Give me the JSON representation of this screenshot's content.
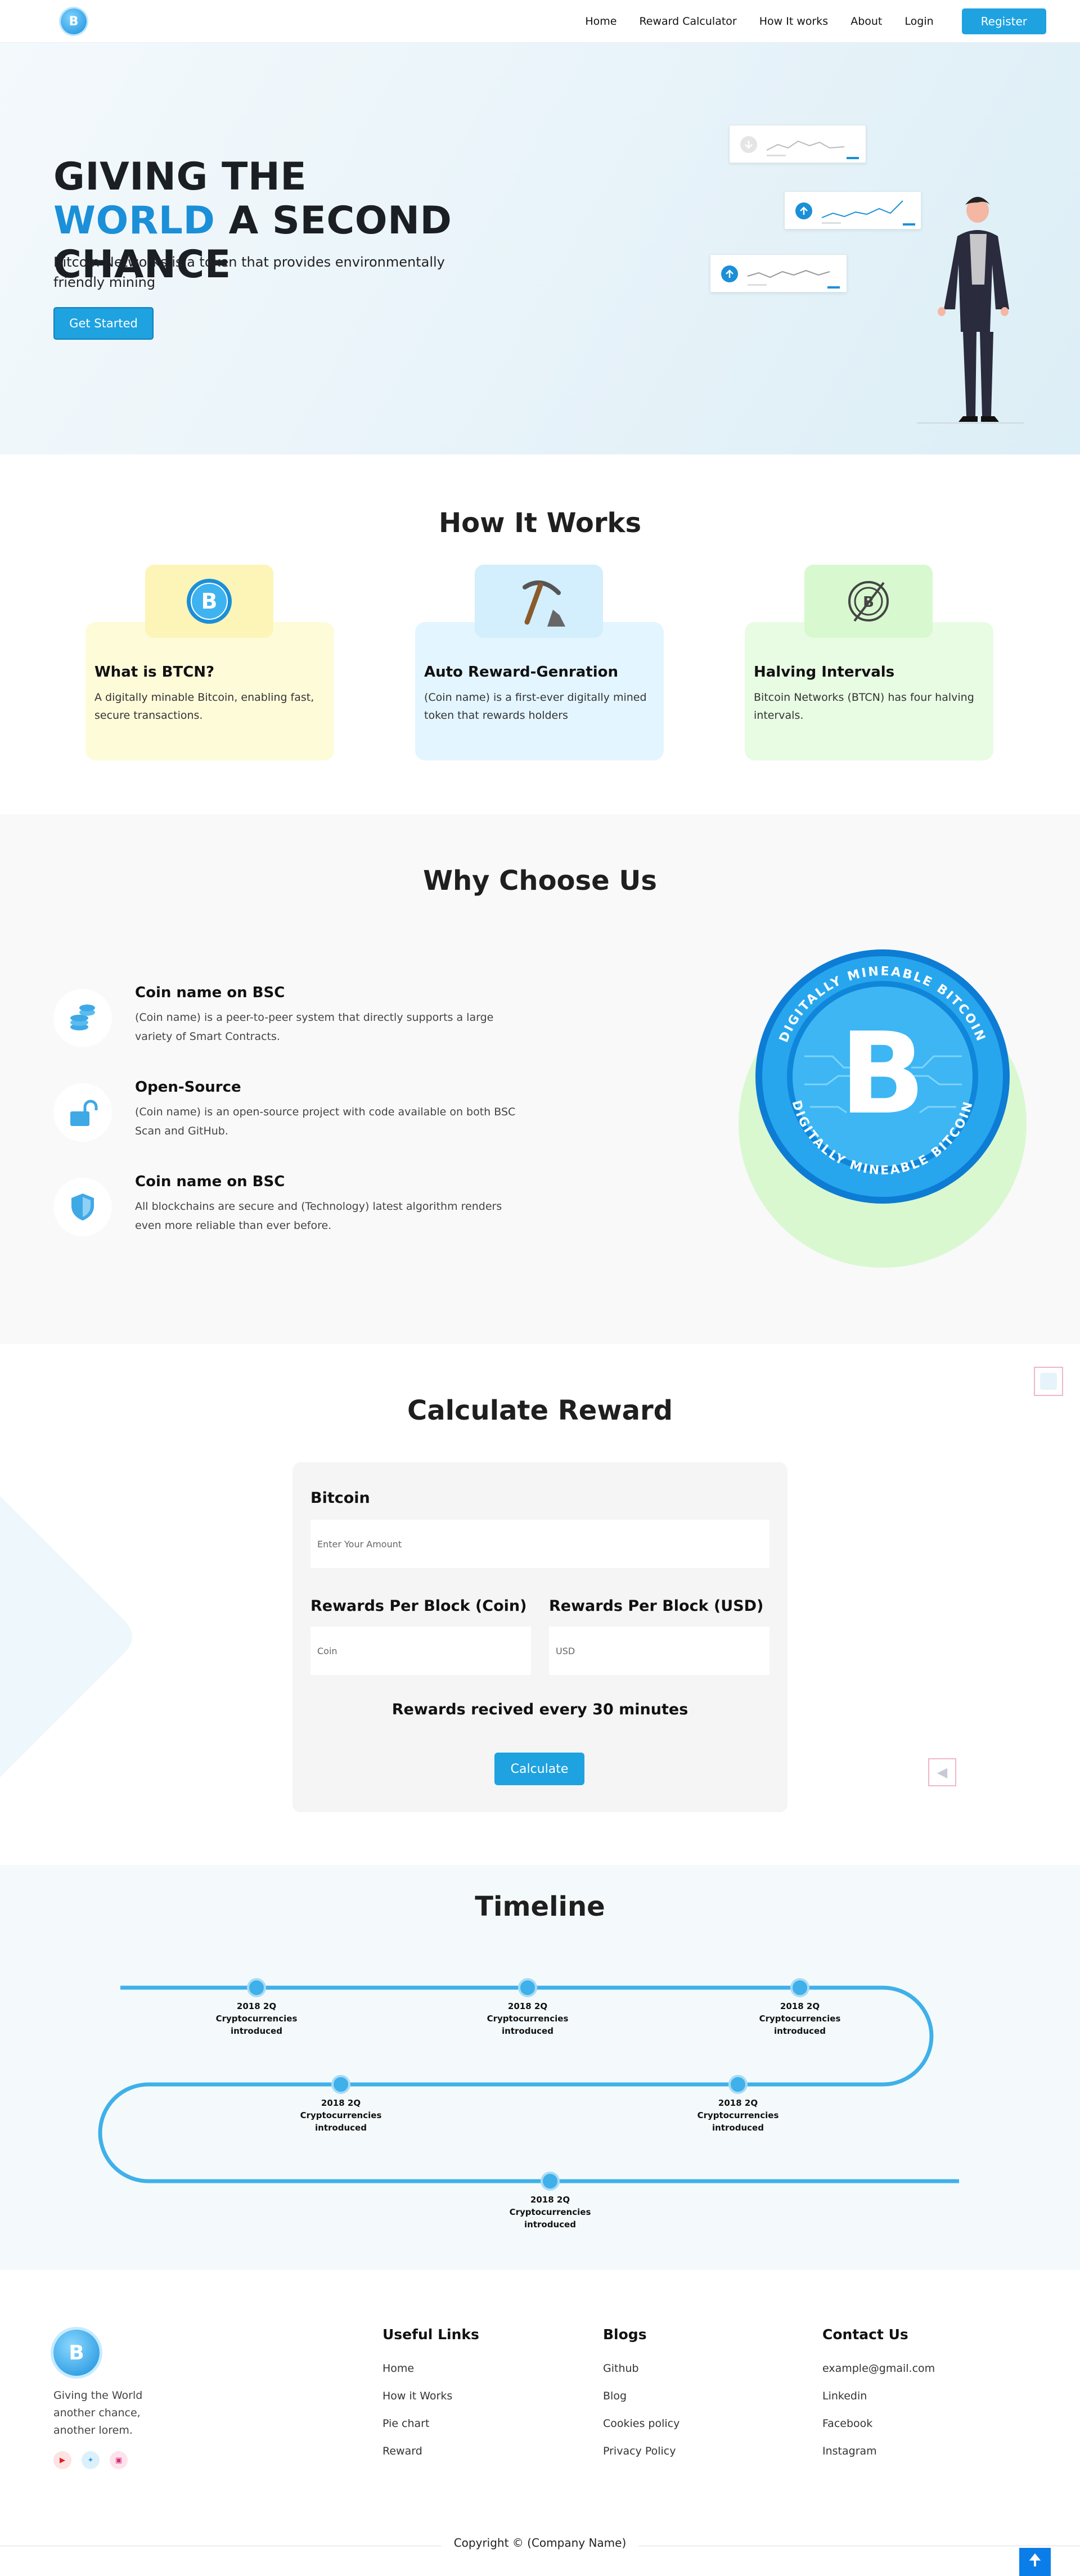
{
  "nav": {
    "logo_text": "B",
    "items": [
      "Home",
      "Reward Calculator",
      "How It works",
      "About",
      "Login"
    ],
    "register": "Register"
  },
  "hero": {
    "title_part1": "GIVING THE ",
    "title_highlight": "WORLD",
    "title_part2": " A SECOND CHANCE",
    "subtitle": "Bitcoin Networks is a token that provides environmentally friendly mining",
    "cta": "Get Started",
    "accent_color": "#1b8fd8"
  },
  "how": {
    "title": "How It Works",
    "cards": [
      {
        "icon": "bitcoin-coin-icon",
        "title": "What is BTCN?",
        "text": "A digitally minable Bitcoin, enabling fast, secure transactions.",
        "bg": "#fefbd9",
        "icon_bg": "#fdf4b8"
      },
      {
        "icon": "pickaxe-icon",
        "title": "Auto Reward-Genration",
        "text": "(Coin name) is a first-ever digitally mined token that rewards holders",
        "bg": "#e3f5ff",
        "icon_bg": "#d3eefc"
      },
      {
        "icon": "halving-icon",
        "title": "Halving Intervals",
        "text": "Bitcoin Networks (BTCN) has four halving intervals.",
        "bg": "#e8fbe3",
        "icon_bg": "#d8f8cf"
      }
    ]
  },
  "why": {
    "title": "Why Choose Us",
    "items": [
      {
        "icon": "coins-stack-icon",
        "title": "Coin name on BSC",
        "text": "(Coin name) is a peer-to-peer system that directly supports a large variety of Smart Contracts."
      },
      {
        "icon": "unlock-icon",
        "title": "Open-Source",
        "text": "(Coin name) is an open-source project with code available on both BSC Scan and GitHub."
      },
      {
        "icon": "shield-icon",
        "title": "Coin name on BSC",
        "text": "All blockchains are secure and (Technology) latest algorithm renders even more reliable than ever before."
      }
    ],
    "badge_text": "DIGITALLY MINEABLE BITCOIN",
    "badge_symbol": "B"
  },
  "calc": {
    "title": "Calculate Reward",
    "bitcoin_label": "Bitcoin",
    "amount_placeholder": "Enter Your Amount",
    "coin_label": "Rewards Per Block (Coin)",
    "usd_label": "Rewards Per Block (USD)",
    "coin_placeholder": "Coin",
    "usd_placeholder": "USD",
    "note": "Rewards recived every 30 minutes",
    "button": "Calculate"
  },
  "timeline": {
    "title": "Timeline",
    "events": [
      {
        "date": "2018 2Q",
        "label": "Cryptocurrencies introduced"
      },
      {
        "date": "2018 2Q",
        "label": "Cryptocurrencies introduced"
      },
      {
        "date": "2018 2Q",
        "label": "Cryptocurrencies introduced"
      },
      {
        "date": "2018 2Q",
        "label": "Cryptocurrencies introduced"
      },
      {
        "date": "2018 2Q",
        "label": "Cryptocurrencies introduced"
      },
      {
        "date": "2018 2Q",
        "label": "Cryptocurrencies introduced"
      }
    ]
  },
  "footer": {
    "logo_text": "B",
    "description": "Giving the World another chance, another lorem.",
    "social": [
      "youtube-icon",
      "twitter-icon",
      "instagram-icon"
    ],
    "useful_links": {
      "title": "Useful Links",
      "links": [
        "Home",
        "How it Works",
        "Pie chart",
        "Reward"
      ]
    },
    "blogs": {
      "title": "Blogs",
      "links": [
        "Github",
        "Blog",
        "Cookies policy",
        "Privacy Policy"
      ]
    },
    "contact": {
      "title": "Contact Us",
      "links": [
        "example@gmail.com",
        "Linkedin",
        "Facebook",
        "Instagram"
      ]
    },
    "copyright": "Copyright © (Company Name)"
  }
}
